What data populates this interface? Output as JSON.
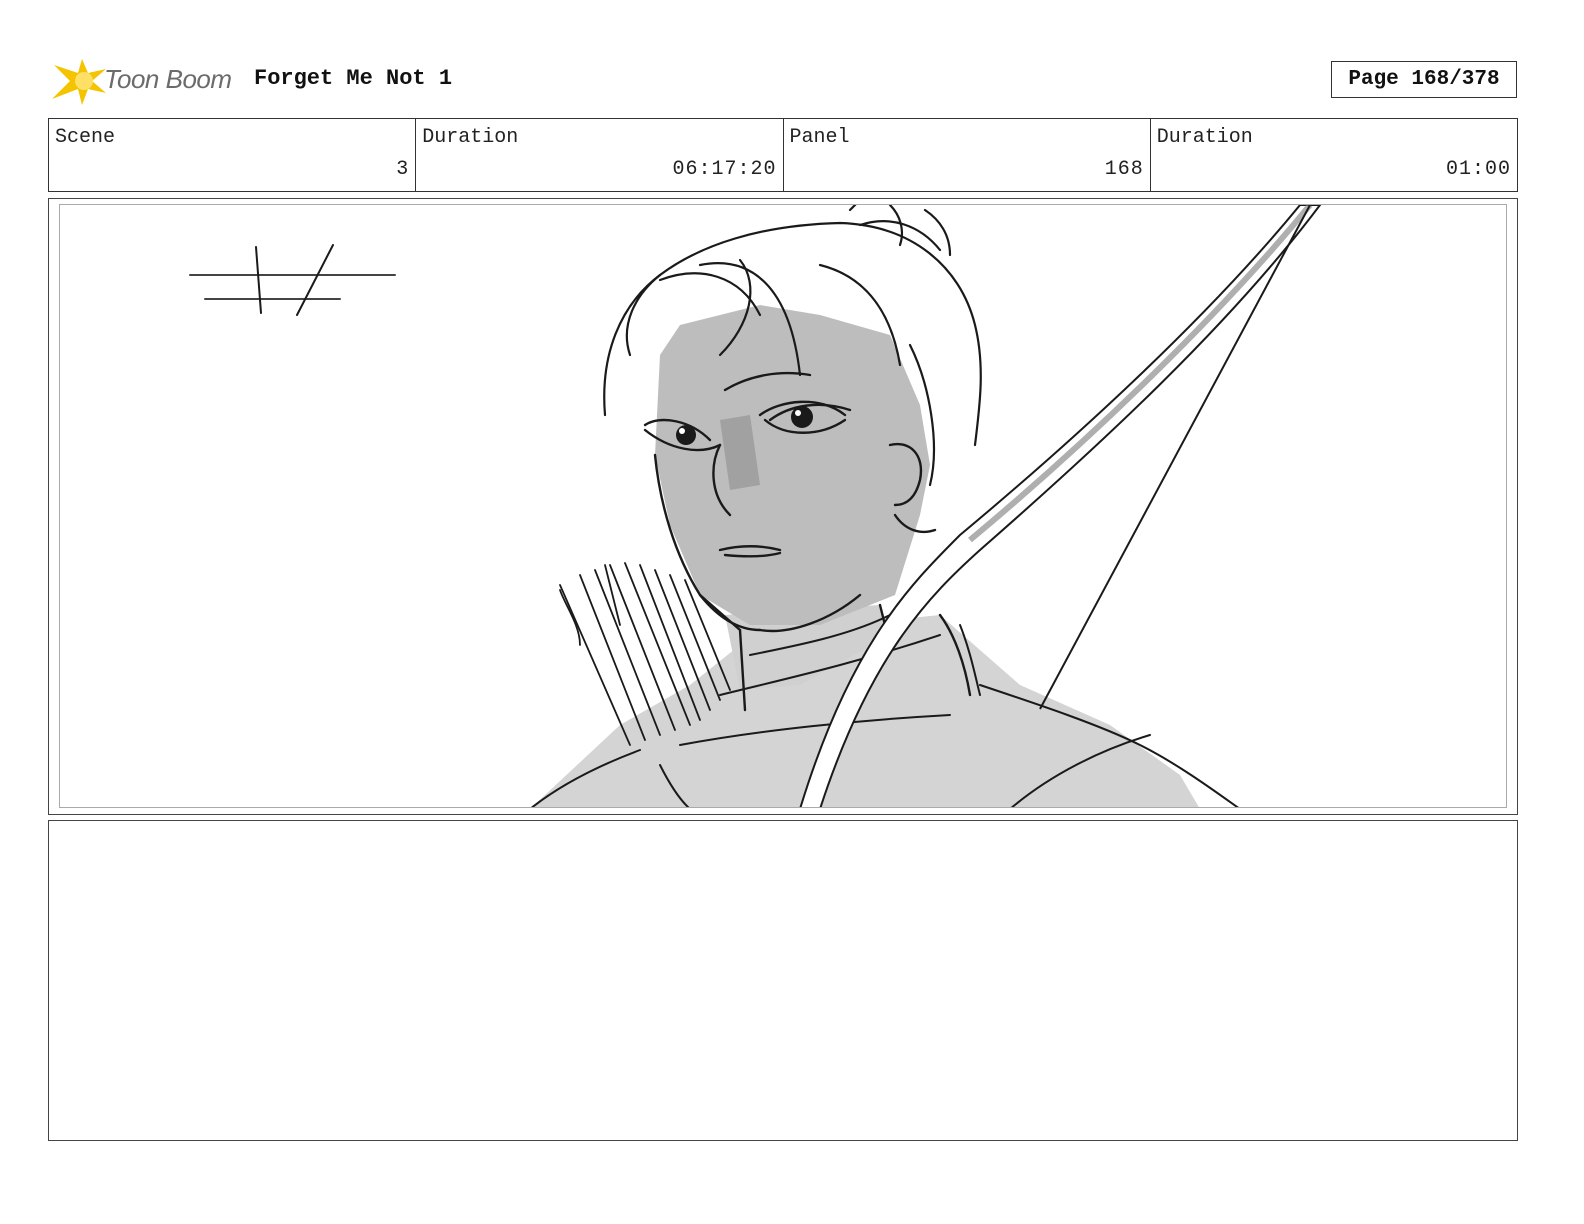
{
  "header": {
    "logo_text": "Toon Boom",
    "title": "Forget Me Not 1",
    "page": "Page 168/378"
  },
  "info": {
    "scene_label": "Scene",
    "scene_value": "3",
    "scene_duration_label": "Duration",
    "scene_duration_value": "06:17:20",
    "panel_label": "Panel",
    "panel_value": "168",
    "panel_duration_label": "Duration",
    "panel_duration_value": "01:00"
  },
  "notes": {
    "text": ""
  },
  "colors": {
    "logo_star": "#f5c400",
    "logo_text": "#6b6b6b",
    "skin_tone": "#bdbdbd"
  }
}
